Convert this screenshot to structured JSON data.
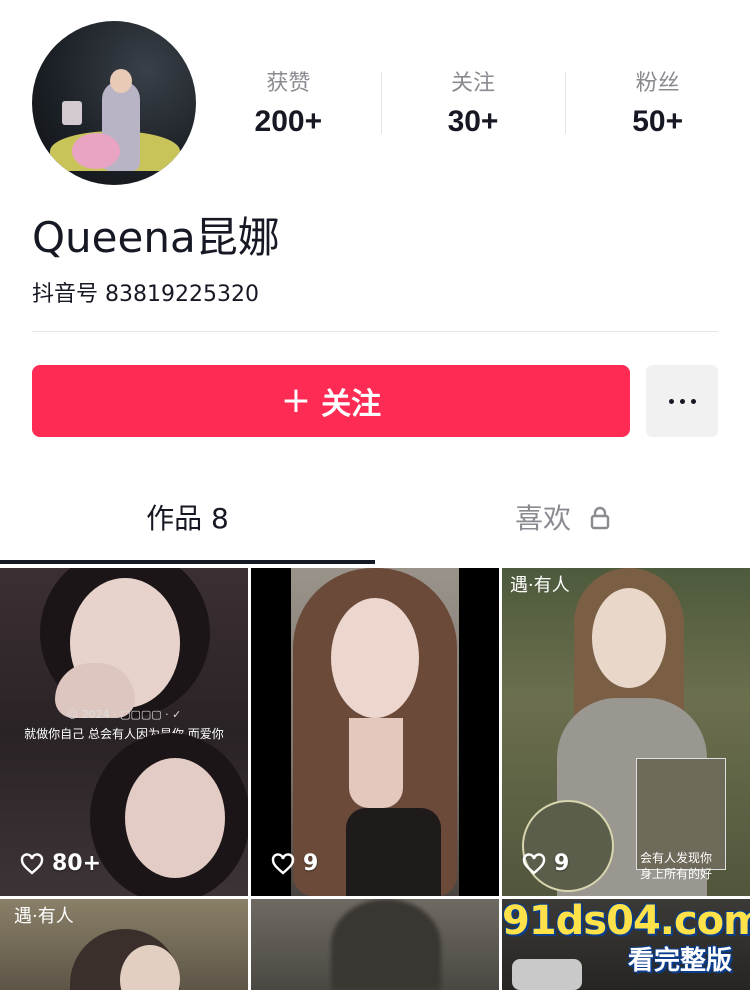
{
  "profile": {
    "name": "Queena昆娜",
    "douyin_id_label": "抖音号",
    "douyin_id": "83819225320"
  },
  "stats": [
    {
      "label": "获赞",
      "value": "200+"
    },
    {
      "label": "关注",
      "value": "30+"
    },
    {
      "label": "粉丝",
      "value": "50+"
    }
  ],
  "actions": {
    "follow_icon": "+",
    "follow_label": "关注",
    "more_icon": "more-dots"
  },
  "tabs": {
    "works_label": "作品",
    "works_count": "8",
    "likes_label": "喜欢",
    "likes_icon": "lock"
  },
  "videos": [
    {
      "likes": "80+",
      "caption_top": "☺ 2024 · ▢▢▢▢ · ✓",
      "caption": "就做你自己 总会有人因为是你 而爱你"
    },
    {
      "likes": "9"
    },
    {
      "likes": "9",
      "stamp": "遇·有人",
      "caption_line1": "会有人发现你",
      "caption_line2": "身上所有的好"
    },
    {
      "stamp": "遇·有人"
    },
    {},
    {}
  ],
  "watermark": {
    "domain": "91ds04.com",
    "sub": "看完整版"
  },
  "colors": {
    "accent": "#fe2c55",
    "text": "#161823",
    "muted": "#8a8b91"
  }
}
